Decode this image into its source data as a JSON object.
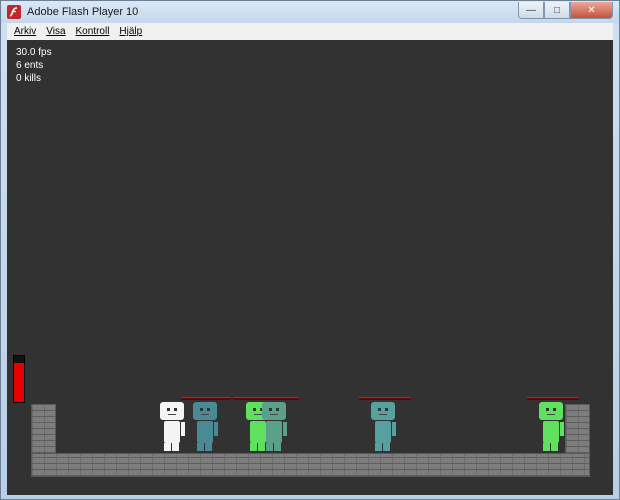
{
  "window": {
    "title": "Adobe Flash Player 10",
    "icon": "flash-player-icon",
    "controls": {
      "minimize": "minimize-icon",
      "maximize": "maximize-icon",
      "close": "close-icon"
    }
  },
  "menu": {
    "items": [
      {
        "label": "Arkiv"
      },
      {
        "label": "Visa"
      },
      {
        "label": "Kontroll"
      },
      {
        "label": "Hjälp"
      }
    ]
  },
  "hud": {
    "fps": "30.0 fps",
    "ents": "6 ents",
    "kills": "0 kills"
  },
  "player": {
    "health_fraction": 0.85,
    "health_color": "#e60000"
  },
  "characters": [
    {
      "id": "player",
      "color": "#f4f4f4"
    },
    {
      "id": "enemy-1",
      "color": "#4a8a96"
    },
    {
      "id": "enemy-2",
      "color": "#5fe05f"
    },
    {
      "id": "enemy-3",
      "color": "#5aa08a"
    },
    {
      "id": "enemy-4",
      "color": "#56a0a0"
    },
    {
      "id": "enemy-5",
      "color": "#5fe05f"
    }
  ],
  "colors": {
    "stage_background": "#323232",
    "brick": "#7d7d7d",
    "enemy_health": "#6a0000"
  }
}
